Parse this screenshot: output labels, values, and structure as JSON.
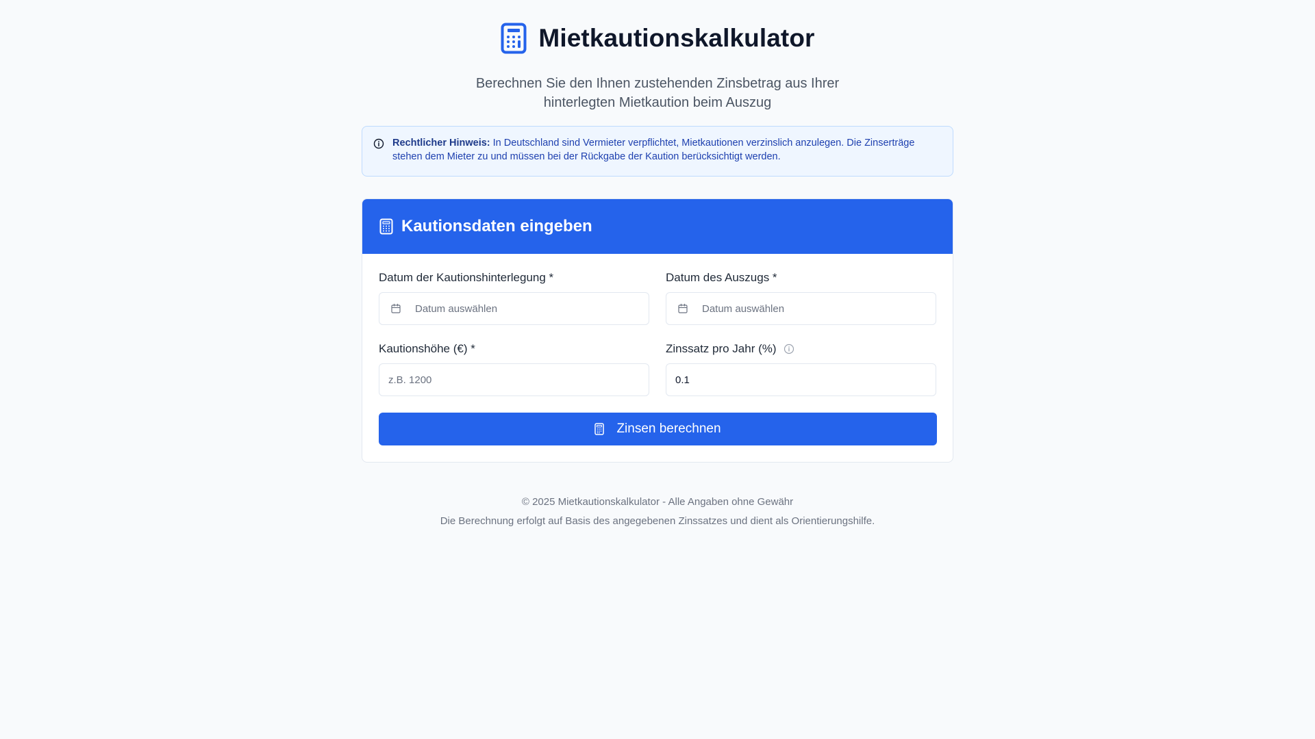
{
  "header": {
    "title": "Mietkautionskalkulator",
    "subtitle": "Berechnen Sie den Ihnen zustehenden Zinsbetrag aus Ihrer hinterlegten Mietkaution beim Auszug",
    "icon": "calculator-icon"
  },
  "notice": {
    "icon": "info-circle-icon",
    "strong": "Rechtlicher Hinweis:",
    "text": " In Deutschland sind Vermieter verpflichtet, Mietkautionen verzinslich anzulegen. Die Zinserträge stehen dem Mieter zu und müssen bei der Rückgabe der Kaution berücksichtigt werden."
  },
  "card": {
    "title": "Kautionsdaten eingeben",
    "icon": "calculator-icon"
  },
  "form": {
    "deposit_date": {
      "label": "Datum der Kautionshinterlegung *",
      "placeholder": "Datum auswählen",
      "icon": "calendar-icon"
    },
    "moveout_date": {
      "label": "Datum des Auszugs *",
      "placeholder": "Datum auswählen",
      "icon": "calendar-icon"
    },
    "deposit_amount": {
      "label": "Kautionshöhe (€) *",
      "placeholder": "z.B. 1200",
      "value": ""
    },
    "interest_rate": {
      "label": "Zinssatz pro Jahr (%)",
      "value": "0.1",
      "icon": "info-circle-icon"
    },
    "submit": {
      "label": "Zinsen berechnen",
      "icon": "calculator-icon"
    }
  },
  "footer": {
    "line1": "© 2025 Mietkautionskalkulator - Alle Angaben ohne Gewähr",
    "line2": "Die Berechnung erfolgt auf Basis des angegebenen Zinssatzes und dient als Orientierungshilfe."
  },
  "colors": {
    "accent": "#2563eb",
    "background": "#f8fafc",
    "notice_bg": "#eff6ff",
    "notice_text": "#1e40af"
  }
}
